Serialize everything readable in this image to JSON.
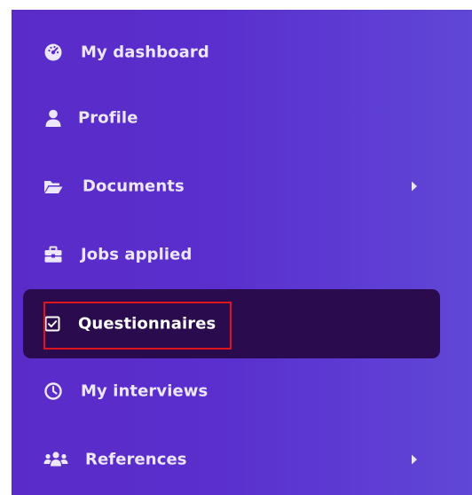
{
  "sidebar": {
    "items": [
      {
        "label": "My dashboard",
        "icon": "dashboard-icon",
        "has_submenu": false,
        "active": false
      },
      {
        "label": "Profile",
        "icon": "user-icon",
        "has_submenu": false,
        "active": false
      },
      {
        "label": "Documents",
        "icon": "folder-open-icon",
        "has_submenu": true,
        "active": false
      },
      {
        "label": "Jobs applied",
        "icon": "briefcase-icon",
        "has_submenu": false,
        "active": false
      },
      {
        "label": "Questionnaires",
        "icon": "checkbox-icon",
        "has_submenu": false,
        "active": true
      },
      {
        "label": "My interviews",
        "icon": "clock-icon",
        "has_submenu": false,
        "active": false
      },
      {
        "label": "References",
        "icon": "users-icon",
        "has_submenu": true,
        "active": false
      }
    ]
  },
  "colors": {
    "sidebar_gradient_start": "#5a2bc8",
    "sidebar_gradient_end": "#6047d6",
    "active_background": "#2a0b4d",
    "text": "#ece6ff",
    "highlight_border": "#e0141e"
  }
}
